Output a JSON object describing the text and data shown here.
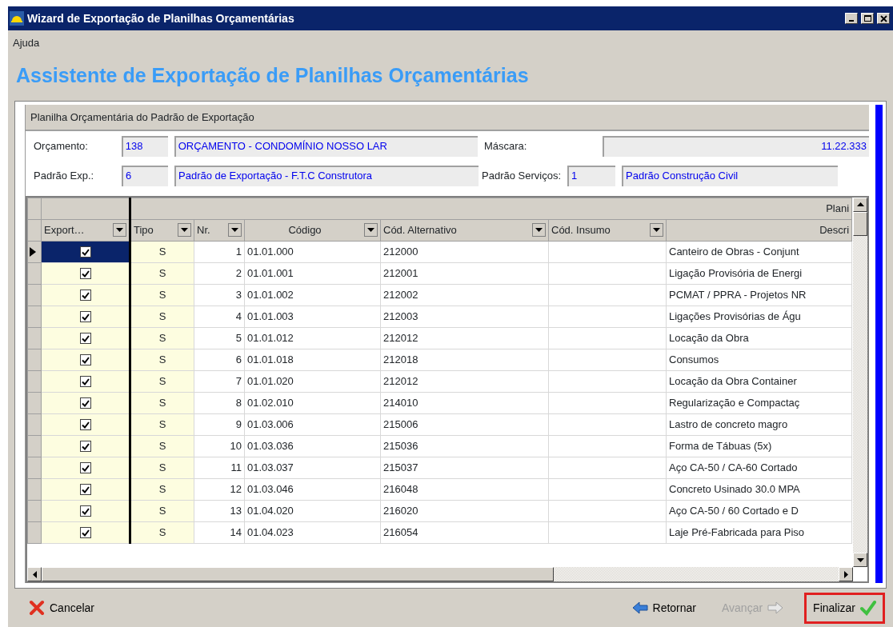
{
  "window": {
    "title": "Wizard de Exportação de Planilhas Orçamentárias"
  },
  "menu": [
    {
      "label": "Ajuda"
    }
  ],
  "heading": "Assistente de Exportação de Planilhas Orçamentárias",
  "group": {
    "title": "Planilha Orçamentária do Padrão de Exportação",
    "fields": [
      {
        "label": "Orçamento:",
        "code": "138",
        "value": "ORÇAMENTO - CONDOMÍNIO NOSSO LAR"
      },
      {
        "label": "Padrão Exp.:",
        "code": "6",
        "value": "Padrão de Exportação - F.T.C Construtora"
      }
    ],
    "mask": {
      "label": "Máscara:",
      "value": "11.22.333"
    },
    "services": {
      "label": "Padrão Serviços:",
      "code": "1",
      "value": "Padrão Construção Civil"
    }
  },
  "table": {
    "band_title": "Plani",
    "columns": [
      {
        "label": "Export…",
        "filter": true
      },
      {
        "label": "Tipo",
        "filter": true
      },
      {
        "label": "Nr.",
        "filter": true
      },
      {
        "label": "Código",
        "filter": true
      },
      {
        "label": "Cód. Alternativo",
        "filter": true
      },
      {
        "label": "Cód. Insumo",
        "filter": true
      },
      {
        "label": "Descri",
        "filter": false
      }
    ],
    "rows": [
      {
        "selected": true,
        "checked": true,
        "tipo": "S",
        "nr": "1",
        "codigo": "01.01.000",
        "alternativo": "212000",
        "insumo": "",
        "descricao": "Canteiro de Obras - Conjunt"
      },
      {
        "selected": false,
        "checked": true,
        "tipo": "S",
        "nr": "2",
        "codigo": "01.01.001",
        "alternativo": "212001",
        "insumo": "",
        "descricao": "Ligação Provisória de Energi"
      },
      {
        "selected": false,
        "checked": true,
        "tipo": "S",
        "nr": "3",
        "codigo": "01.01.002",
        "alternativo": "212002",
        "insumo": "",
        "descricao": "PCMAT / PPRA - Projetos NR"
      },
      {
        "selected": false,
        "checked": true,
        "tipo": "S",
        "nr": "4",
        "codigo": "01.01.003",
        "alternativo": "212003",
        "insumo": "",
        "descricao": "Ligações Provisórias de Águ"
      },
      {
        "selected": false,
        "checked": true,
        "tipo": "S",
        "nr": "5",
        "codigo": "01.01.012",
        "alternativo": "212012",
        "insumo": "",
        "descricao": "Locação da Obra"
      },
      {
        "selected": false,
        "checked": true,
        "tipo": "S",
        "nr": "6",
        "codigo": "01.01.018",
        "alternativo": "212018",
        "insumo": "",
        "descricao": "Consumos"
      },
      {
        "selected": false,
        "checked": true,
        "tipo": "S",
        "nr": "7",
        "codigo": "01.01.020",
        "alternativo": "212012",
        "insumo": "",
        "descricao": "Locação da Obra Container"
      },
      {
        "selected": false,
        "checked": true,
        "tipo": "S",
        "nr": "8",
        "codigo": "01.02.010",
        "alternativo": "214010",
        "insumo": "",
        "descricao": "Regularização e Compactaç"
      },
      {
        "selected": false,
        "checked": true,
        "tipo": "S",
        "nr": "9",
        "codigo": "01.03.006",
        "alternativo": "215006",
        "insumo": "",
        "descricao": "Lastro de concreto magro"
      },
      {
        "selected": false,
        "checked": true,
        "tipo": "S",
        "nr": "10",
        "codigo": "01.03.036",
        "alternativo": "215036",
        "insumo": "",
        "descricao": "Forma de Tábuas (5x)"
      },
      {
        "selected": false,
        "checked": true,
        "tipo": "S",
        "nr": "11",
        "codigo": "01.03.037",
        "alternativo": "215037",
        "insumo": "",
        "descricao": "Aço CA-50 / CA-60 Cortado"
      },
      {
        "selected": false,
        "checked": true,
        "tipo": "S",
        "nr": "12",
        "codigo": "01.03.046",
        "alternativo": "216048",
        "insumo": "",
        "descricao": "Concreto Usinado 30.0 MPA"
      },
      {
        "selected": false,
        "checked": true,
        "tipo": "S",
        "nr": "13",
        "codigo": "01.04.020",
        "alternativo": "216020",
        "insumo": "",
        "descricao": "Aço CA-50 / 60 Cortado e D"
      },
      {
        "selected": false,
        "checked": true,
        "tipo": "S",
        "nr": "14",
        "codigo": "01.04.023",
        "alternativo": "216054",
        "insumo": "",
        "descricao": "Laje Pré-Fabricada para Piso"
      }
    ]
  },
  "footer": [
    {
      "kind": "cancel",
      "label": "Cancelar",
      "disabled": false,
      "highlighted": false
    },
    {
      "kind": "back",
      "label": "Retornar",
      "disabled": false,
      "highlighted": false
    },
    {
      "kind": "next",
      "label": "Avançar",
      "disabled": true,
      "highlighted": false
    },
    {
      "kind": "finish",
      "label": "Finalizar",
      "disabled": false,
      "highlighted": true
    }
  ]
}
